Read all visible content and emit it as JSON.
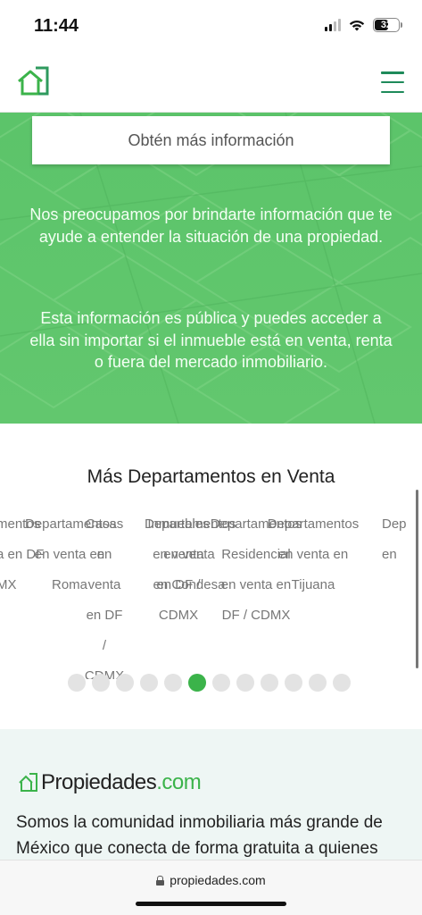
{
  "status_bar": {
    "time": "11:44",
    "battery": "32",
    "icons": [
      "signal-icon",
      "wifi-icon",
      "battery-icon"
    ]
  },
  "header": {
    "logo_icon": "house-logo-icon",
    "menu_icon": "hamburger-menu-icon"
  },
  "hero": {
    "button_label": "Obtén más información",
    "paragraph_1": "Nos preocupamos por brindarte información que te ayude a entender la situación de una propiedad.",
    "paragraph_2": "Esta información es pública y puedes acceder a ella sin importar si el inmueble está en venta, renta o fuera del mercado inmobiliario."
  },
  "more_section": {
    "title": "Más Departamentos en Venta",
    "carousel_lines": [
      {
        "lines": [
          "mentos",
          "a en DF",
          "MX"
        ]
      },
      {
        "lines": [
          "Departamentos",
          "en venta en",
          "Roma"
        ]
      },
      {
        "lines": [
          "Casas",
          "en",
          "venta",
          "en DF",
          "/",
          "CDMX"
        ]
      },
      {
        "lines": [
          "Departamentos",
          "en venta",
          "en Condesa"
        ]
      },
      {
        "lines": [
          "Inmuebles",
          "en venta",
          "en DF /",
          "CDMX"
        ]
      },
      {
        "lines": [
          "Departamentos",
          "Residencial",
          "en venta en",
          "DF / CDMX"
        ]
      },
      {
        "lines": [
          "Departamentos",
          "en venta en",
          "Tijuana"
        ]
      },
      {
        "lines": [
          "Dep",
          "en"
        ]
      }
    ],
    "dots_total": 12,
    "active_dot": 5
  },
  "footer": {
    "brand_name": "Propiedades",
    "brand_tld": ".com",
    "text": "Somos la comunidad inmobiliaria más grande de México que conecta de forma gratuita a quienes"
  },
  "url_bar": {
    "url": "propiedades.com"
  },
  "colors": {
    "brand_green": "#3bb34a",
    "hero_green": "#5cc46a",
    "menu_green": "#1e8a5a"
  }
}
